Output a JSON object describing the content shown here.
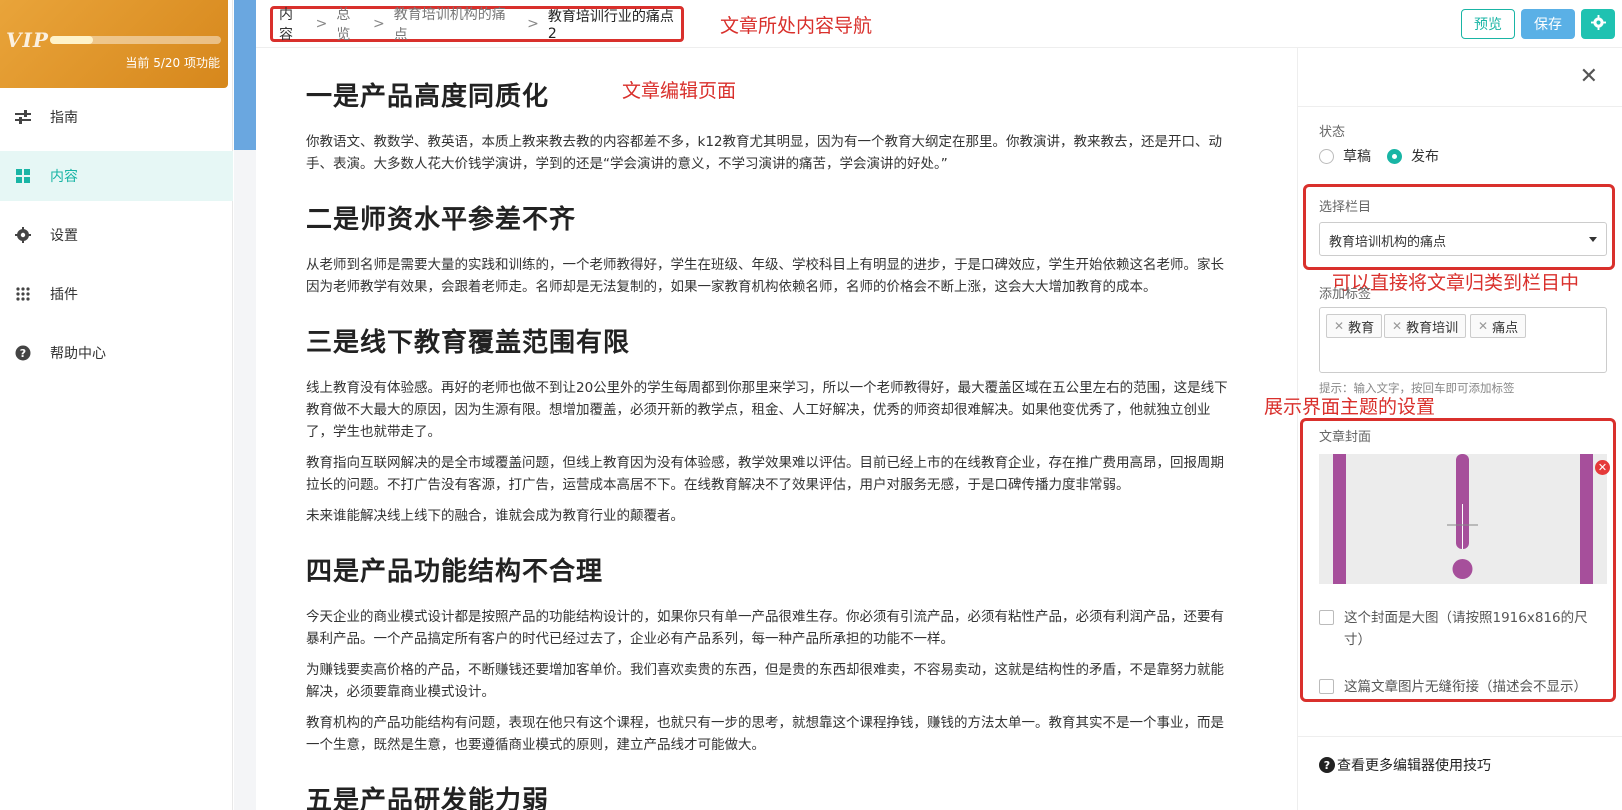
{
  "vip": {
    "logo": "VIP",
    "progress_percent": 25,
    "status": "当前 5/20 项功能"
  },
  "nav": {
    "items": [
      {
        "label": "指南",
        "icon": "sliders-icon"
      },
      {
        "label": "内容",
        "icon": "grid-icon",
        "active": true
      },
      {
        "label": "设置",
        "icon": "gear-icon"
      },
      {
        "label": "插件",
        "icon": "dots-grid-icon"
      },
      {
        "label": "帮助中心",
        "icon": "help-icon"
      }
    ]
  },
  "breadcrumb": {
    "items": [
      "内容",
      "总览",
      "教育培训机构的痛点",
      "教育培训行业的痛点2"
    ],
    "separator": ">"
  },
  "annotations": {
    "nav_note": "文章所处内容导航",
    "page_note": "文章编辑页面",
    "category_note": "可以直接将文章归类到栏目中",
    "theme_note": "展示界面主题的设置"
  },
  "toolbar": {
    "preview_label": "预览",
    "save_label": "保存"
  },
  "article": {
    "sections": [
      {
        "heading": "一是产品高度同质化",
        "paragraphs": [
          "你教语文、教数学、教英语，本质上教来教去教的内容都差不多，k12教育尤其明显，因为有一个教育大纲定在那里。你教演讲，教来教去，还是开口、动手、表演。大多数人花大价钱学演讲，学到的还是“学会演讲的意义，不学习演讲的痛苦，学会演讲的好处。”"
        ]
      },
      {
        "heading": "二是师资水平参差不齐",
        "paragraphs": [
          "从老师到名师是需要大量的实践和训练的，一个老师教得好，学生在班级、年级、学校科目上有明显的进步，于是口碑效应，学生开始依赖这名老师。家长因为老师教学有效果，会跟着老师走。名师却是无法复制的，如果一家教育机构依赖名师，名师的价格会不断上涨，这会大大增加教育的成本。"
        ]
      },
      {
        "heading": "三是线下教育覆盖范围有限",
        "paragraphs": [
          "线上教育没有体验感。再好的老师也做不到让20公里外的学生每周都到你那里来学习，所以一个老师教得好，最大覆盖区域在五公里左右的范围，这是线下教育做不大最大的原因，因为生源有限。想增加覆盖，必须开新的教学点，租金、人工好解决，优秀的师资却很难解决。如果他变优秀了，他就独立创业了，学生也就带走了。",
          "教育指向互联网解决的是全市域覆盖问题，但线上教育因为没有体验感，教学效果难以评估。目前已经上市的在线教育企业，存在推广费用高昂，回报周期拉长的问题。不打广告没有客源，打广告，运营成本高居不下。在线教育解决不了效果评估，用户对服务无感，于是口碑传播力度非常弱。",
          "未来谁能解决线上线下的融合，谁就会成为教育行业的颠覆者。"
        ]
      },
      {
        "heading": "四是产品功能结构不合理",
        "paragraphs": [
          "今天企业的商业模式设计都是按照产品的功能结构设计的，如果你只有单一产品很难生存。你必须有引流产品，必须有粘性产品，必须有利润产品，还要有暴利产品。一个产品搞定所有客户的时代已经过去了，企业必有产品系列，每一种产品所承担的功能不一样。",
          "为赚钱要卖高价格的产品，不断赚钱还要增加客单价。我们喜欢卖贵的东西，但是贵的东西却很难卖，不容易卖动，这就是结构性的矛盾，不是靠努力就能解决，必须要靠商业模式设计。",
          "教育机构的产品功能结构有问题，表现在他只有这个课程，也就只有一步的思考，就想靠这个课程挣钱，赚钱的方法太单一。教育其实不是一个事业，而是一个生意，既然是生意，也要遵循商业模式的原则，建立产品线才可能做大。"
        ]
      },
      {
        "heading": "五是产品研发能力弱",
        "paragraphs": []
      }
    ]
  },
  "panel": {
    "status_label": "状态",
    "status_options": [
      {
        "label": "草稿",
        "selected": false
      },
      {
        "label": "发布",
        "selected": true
      }
    ],
    "category_label": "选择栏目",
    "category_value": "教育培训机构的痛点",
    "tags_label": "添加标签",
    "tags": [
      "教育",
      "教育培训",
      "痛点"
    ],
    "tags_hint": "提示：输入文字，按回车即可添加标签",
    "cover_label": "文章封面",
    "cover_large_label": "这个封面是大图（请按照1916x816的尺寸）",
    "seamless_label": "这篇文章图片无缝衔接（描述会不显示）",
    "tips_label": "查看更多编辑器使用技巧"
  },
  "colors": {
    "accent": "#19b5a5",
    "annotation": "#d9302c",
    "vip_gold": "#e19a30",
    "save_blue": "#5ab0e6",
    "cover_purple": "#a64f9b"
  }
}
